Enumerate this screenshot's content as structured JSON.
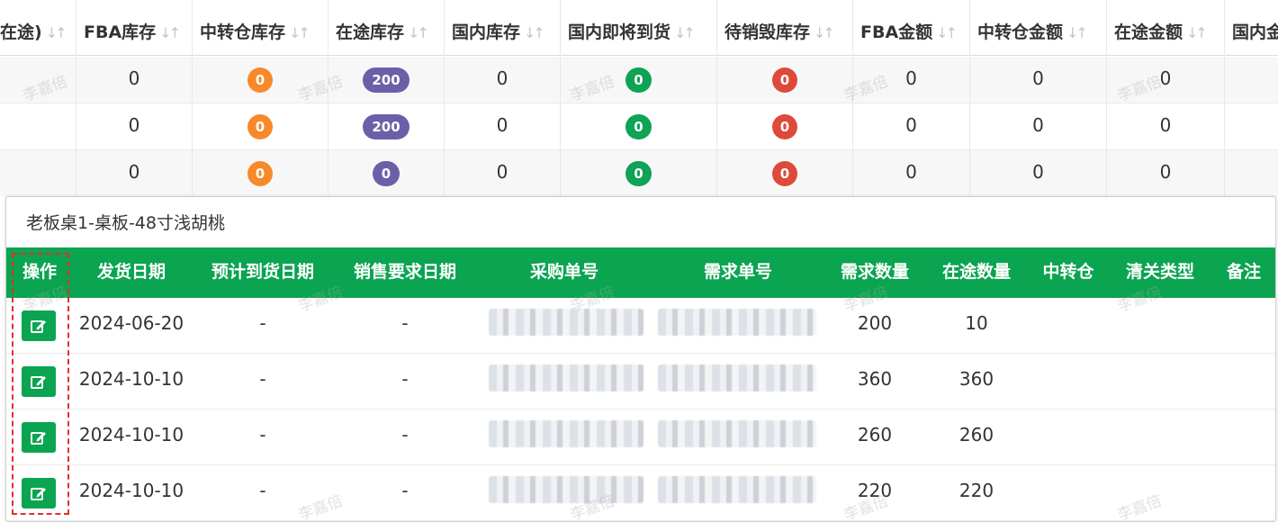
{
  "inventory": {
    "headers": [
      "在途)",
      "FBA库存",
      "中转仓库存",
      "在途库存",
      "国内库存",
      "国内即将到货",
      "待销毁库存",
      "FBA金额",
      "中转仓金额",
      "在途金额",
      "国内金"
    ],
    "rows": [
      {
        "fba": "0",
        "transit_wh": "0",
        "in_transit": "200",
        "domestic": "0",
        "incoming": "0",
        "to_destroy": "0",
        "fba_amount": "0",
        "transit_amount": "0",
        "in_transit_amount": "0"
      },
      {
        "fba": "0",
        "transit_wh": "0",
        "in_transit": "200",
        "domestic": "0",
        "incoming": "0",
        "to_destroy": "0",
        "fba_amount": "0",
        "transit_amount": "0",
        "in_transit_amount": "0"
      },
      {
        "fba": "0",
        "transit_wh": "0",
        "in_transit": "0",
        "domestic": "0",
        "incoming": "0",
        "to_destroy": "0",
        "fba_amount": "0",
        "transit_amount": "0",
        "in_transit_amount": "0"
      }
    ]
  },
  "detail": {
    "title": "老板桌1-桌板-48寸浅胡桃",
    "headers": [
      "操作",
      "发货日期",
      "预计到货日期",
      "销售要求日期",
      "采购单号",
      "需求单号",
      "需求数量",
      "在途数量",
      "中转仓",
      "清关类型",
      "备注"
    ],
    "rows": [
      {
        "ship_date": "2024-06-20",
        "eta": "-",
        "sales_date": "-",
        "demand_qty": "200",
        "transit_qty": "10"
      },
      {
        "ship_date": "2024-10-10",
        "eta": "-",
        "sales_date": "-",
        "demand_qty": "360",
        "transit_qty": "360"
      },
      {
        "ship_date": "2024-10-10",
        "eta": "-",
        "sales_date": "-",
        "demand_qty": "260",
        "transit_qty": "260"
      },
      {
        "ship_date": "2024-10-10",
        "eta": "-",
        "sales_date": "-",
        "demand_qty": "220",
        "transit_qty": "220"
      }
    ]
  },
  "watermark": "李嘉倍",
  "icons": {
    "edit": "edit-icon",
    "sort": "sort-icon"
  },
  "colors": {
    "header_green": "#0ba450",
    "badge_orange": "#f7892a",
    "badge_purple": "#6a60a9",
    "badge_green": "#0ea356",
    "badge_red": "#dd4a3a",
    "highlight_red": "#e0302a"
  }
}
